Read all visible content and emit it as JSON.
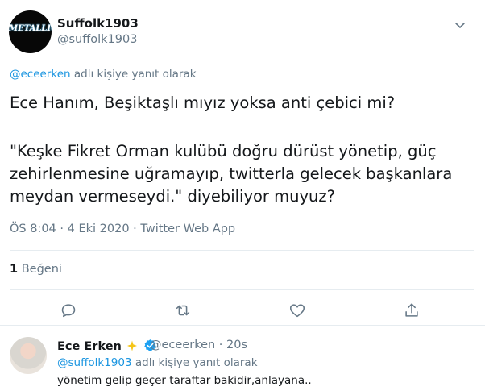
{
  "tweet": {
    "author": {
      "display_name": "Suffolk1903",
      "handle": "@suffolk1903",
      "avatar_logo_text": "METALLICA"
    },
    "reply_context": {
      "mention": "@eceerken",
      "suffix": " adlı kişiye yanıt olarak"
    },
    "text_line1": "Ece Hanım, Beşiktaşlı mıyız yoksa anti çebici mi?",
    "text_line2": "\"Keşke Fikret Orman kulübü doğru dürüst yönetip, güç zehirlenmesine uğramayıp, twitterla gelecek başkanlara meydan vermeseydi.\" diyebiliyor muyuz?",
    "meta": "ÖS 8:04 · 4 Eki 2020 · Twitter Web App",
    "likes_count": "1",
    "likes_label": " Beğeni"
  },
  "actions": [
    "reply-icon",
    "retweet-icon",
    "like-icon",
    "share-icon"
  ],
  "reply": {
    "display_name": "Ece Erken",
    "handle_time": "@eceerken · 20s",
    "reply_context": {
      "mention": "@suffolk1903",
      "suffix": " adlı kişiye yanıt olarak"
    },
    "text": "yönetim gelip geçer taraftar bakidir,anlayana.."
  },
  "colors": {
    "accent": "#1b95e0",
    "secondary_text": "#657786",
    "divider": "#e6ecf0",
    "verified": "#1da1f2"
  }
}
